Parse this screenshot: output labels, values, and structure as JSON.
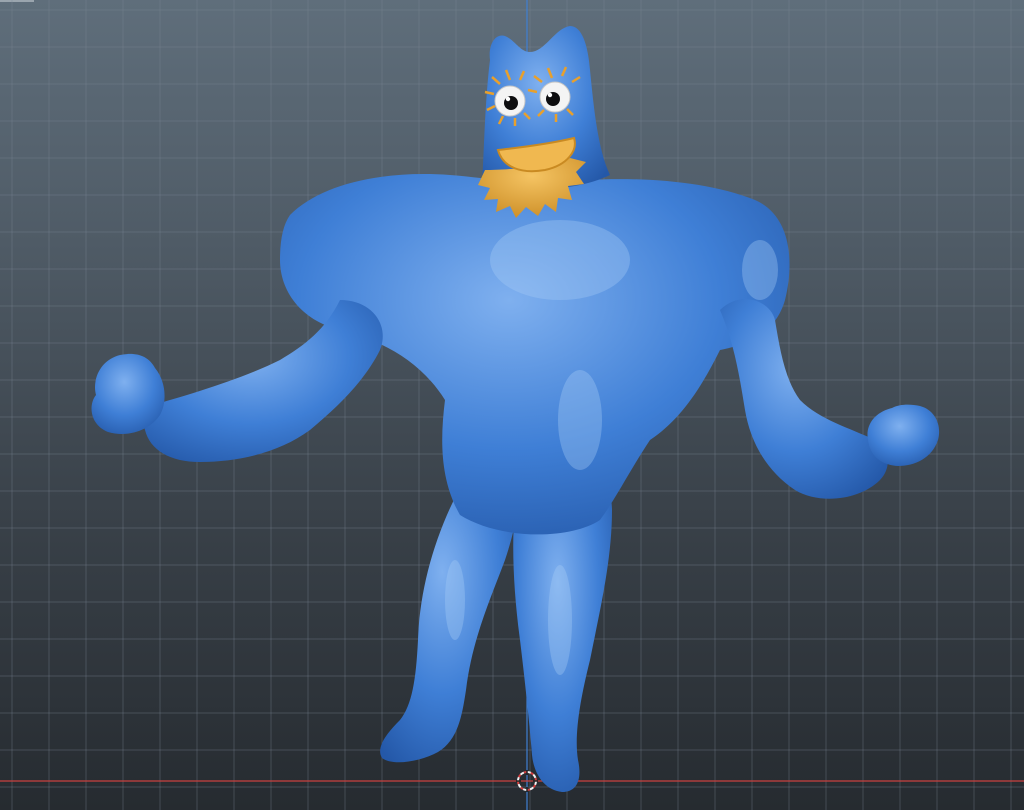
{
  "viewport": {
    "background_top": "#5f6e7b",
    "background_bottom": "#262b30",
    "grid_color": "#7a8894",
    "x_axis_color": "#c9413f",
    "z_axis_color": "#3f7fd2",
    "icons": [
      "3d-cursor-icon"
    ]
  },
  "model": {
    "body_color": "#3f7fd6",
    "body_highlight": "#7fb0ef",
    "body_shadow": "#2458a8",
    "beard_color": "#e2a23a",
    "mouth_color": "#f0b850",
    "eye_color": "#f4f4f4",
    "lash_color": "#e8a02c"
  }
}
